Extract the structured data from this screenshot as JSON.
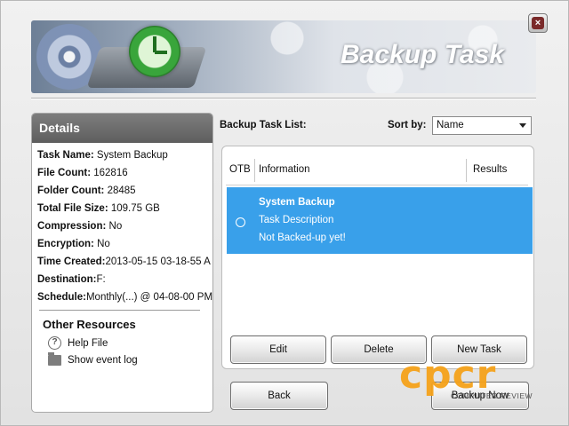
{
  "window": {
    "title": "Backup Task",
    "close_label": "×"
  },
  "details": {
    "header": "Details",
    "rows": [
      {
        "label": "Task Name:",
        "value": " System Backup"
      },
      {
        "label": "File Count:",
        "value": " 162816"
      },
      {
        "label": "Folder Count:",
        "value": " 28485"
      },
      {
        "label": "Total File Size:",
        "value": " 109.75 GB"
      },
      {
        "label": "Compression:",
        "value": " No"
      },
      {
        "label": "Encryption:",
        "value": " No"
      },
      {
        "label": "Time Created:",
        "value": "2013-05-15 03-18-55 A"
      },
      {
        "label": "Destination:",
        "value": "F:"
      },
      {
        "label": "Schedule:",
        "value": "Monthly(...) @ 04-08-00 PM"
      }
    ]
  },
  "resources": {
    "title": "Other Resources",
    "help_label": "Help File",
    "help_glyph": "?",
    "event_log_label": "Show event log"
  },
  "task_list": {
    "label": "Backup Task List:",
    "sort_label": "Sort by:",
    "sort_value": "Name",
    "columns": {
      "otb": "OTB",
      "info": "Information",
      "results": "Results"
    },
    "items": [
      {
        "name": "System Backup",
        "description": "Task Description",
        "status": "Not Backed-up yet!",
        "selected": true
      }
    ]
  },
  "buttons": {
    "edit": "Edit",
    "delete": "Delete",
    "new_task": "New Task",
    "back": "Back",
    "backup_now": "Backup Now"
  },
  "watermark": {
    "logo": "cpcr",
    "sub": "COMPUTER REVIEW"
  },
  "colors": {
    "selection": "#39a0ea",
    "details_header": "#6b6b6b",
    "watermark": "#f5a21a"
  }
}
